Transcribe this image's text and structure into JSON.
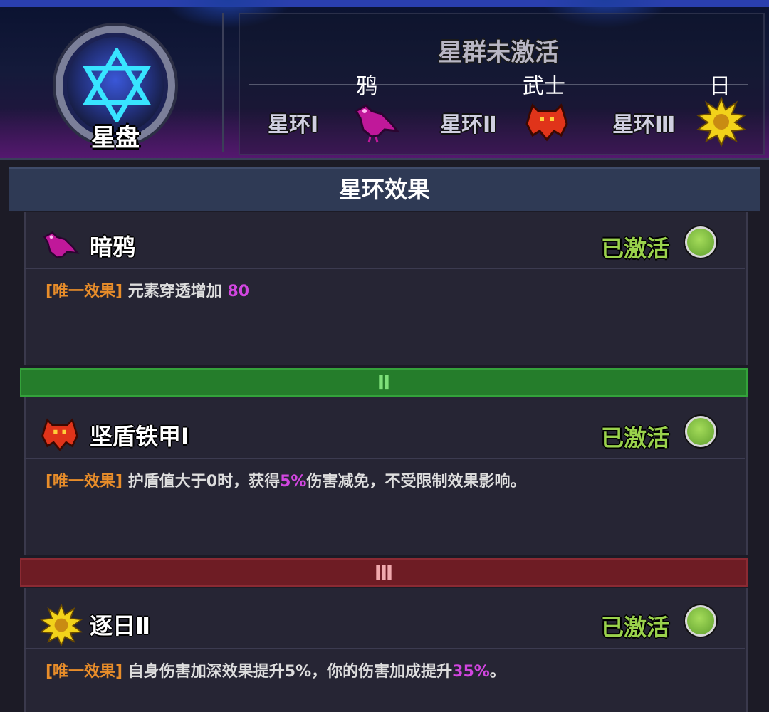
{
  "header": {
    "disc_label": "星盘",
    "cluster_status": "星群未激活",
    "slots": [
      {
        "ring": "星环Ⅰ",
        "name": "鸦",
        "icon": "crow-icon"
      },
      {
        "ring": "星环Ⅱ",
        "name": "武士",
        "icon": "warrior-icon"
      },
      {
        "ring": "星环Ⅲ",
        "name": "日",
        "icon": "sun-icon"
      }
    ]
  },
  "section_title": "星环效果",
  "tiers": {
    "tier2": "Ⅱ",
    "tier3": "Ⅲ"
  },
  "effects": [
    {
      "name": "暗鸦",
      "icon": "crow-icon",
      "status": "已激活",
      "tag": "[唯一效果]",
      "desc_before": "元素穿透增加",
      "highlight": "80",
      "desc_after": ""
    },
    {
      "name": "坚盾铁甲Ⅰ",
      "icon": "warrior-icon",
      "status": "已激活",
      "tag": "[唯一效果]",
      "desc_before": "护盾值大于0时，获得",
      "highlight": "5%",
      "desc_after": "伤害减免，不受限制效果影响。"
    },
    {
      "name": "逐日Ⅱ",
      "icon": "sun-icon",
      "status": "已激活",
      "tag": "[唯一效果]",
      "desc_before": "自身伤害加深效果提升5%，你的伤害加成提升",
      "highlight": "35%",
      "desc_after": "。"
    }
  ],
  "colors": {
    "active_green": "#9ad24c",
    "tag_orange": "#e88d2a",
    "highlight_purple": "#d246e0",
    "tier2_green": "#257d2b",
    "tier3_red": "#6e1c24"
  }
}
